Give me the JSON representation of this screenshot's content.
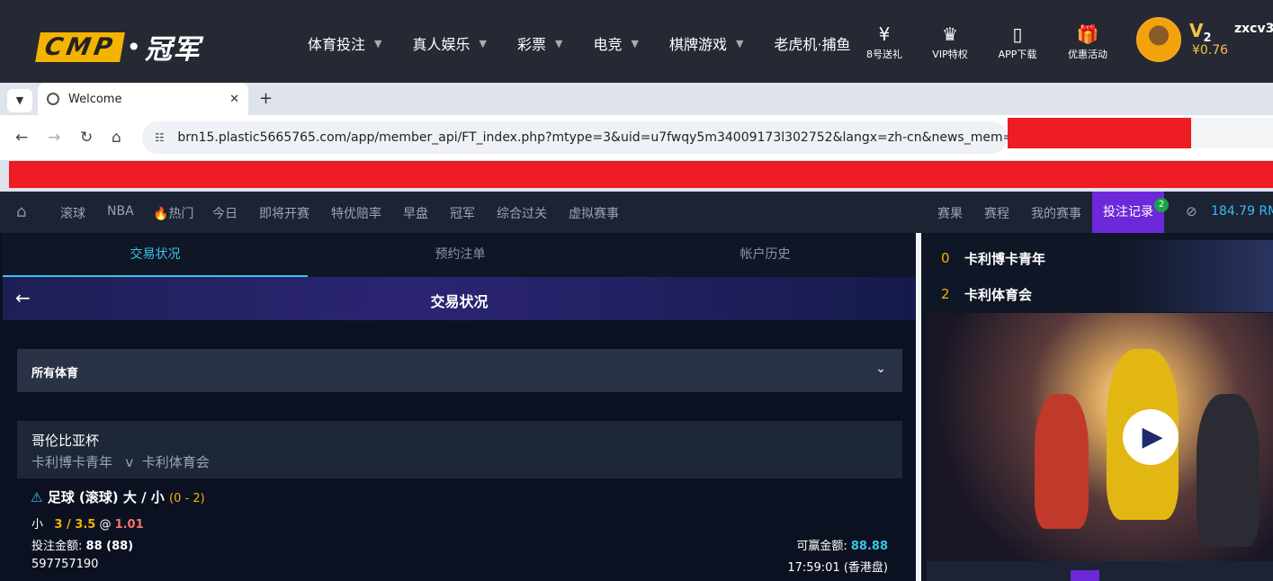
{
  "topbar": {
    "logo_text": "CMP",
    "logo_sep": "•",
    "logo_cn": "冠军",
    "nav": [
      "体育投注",
      "真人娱乐",
      "彩票",
      "电竞",
      "棋牌游戏",
      "老虎机·捕鱼"
    ],
    "quick": [
      {
        "icon": "ticket-yen-icon",
        "glyph": "¥",
        "label": "8号送礼"
      },
      {
        "icon": "crown-icon",
        "glyph": "♛",
        "label": "VIP特权"
      },
      {
        "icon": "phone-icon",
        "glyph": "▯",
        "label": "APP下载"
      },
      {
        "icon": "gift-icon",
        "glyph": "🎁",
        "label": "优惠活动"
      }
    ],
    "vip": "V",
    "vip_level": "2",
    "balance": "¥0.76",
    "username": "zxcv3"
  },
  "browser": {
    "tab_title": "Welcome",
    "new_tab": "+",
    "url": "brn15.plastic5665765.com/app/member_api/FT_index.php?mtype=3&uid=u7fwqy5m34009173l302752&langx=zh-cn&news_mem=Y&..."
  },
  "subnav": {
    "items": [
      "滚球",
      "NBA",
      "🔥热门",
      "今日",
      "即将开赛",
      "特优赔率",
      "早盘",
      "冠军",
      "综合过关",
      "虚拟赛事"
    ],
    "right_items": [
      "赛果",
      "赛程",
      "我的赛事"
    ],
    "bet_record": "投注记录",
    "badge": "2",
    "money": "184.79 RM"
  },
  "left": {
    "tabs": [
      "交易状况",
      "预约注单",
      "帐户历史"
    ],
    "banner_title": "交易状况",
    "sport_select": "所有体育",
    "league": "哥伦比亚杯",
    "home_team": "卡利博卡青年",
    "vs": "v",
    "away_team": "卡利体育会",
    "bet_title": "足球 (滚球) 大 / 小",
    "score": "(0 - 2)",
    "pick_side": "小",
    "pick_line": "3 / 3.5",
    "at": "@",
    "odds": "1.01",
    "stake_label": "投注金额:",
    "stake_value": "88 (88)",
    "win_label": "可赢金额:",
    "win_value": "88.88",
    "order_id": "597757190",
    "time": "17:59:01 (香港盘)"
  },
  "right": {
    "teams": [
      {
        "num": "0",
        "name": "卡利博卡青年"
      },
      {
        "num": "2",
        "name": "卡利体育会"
      }
    ]
  }
}
